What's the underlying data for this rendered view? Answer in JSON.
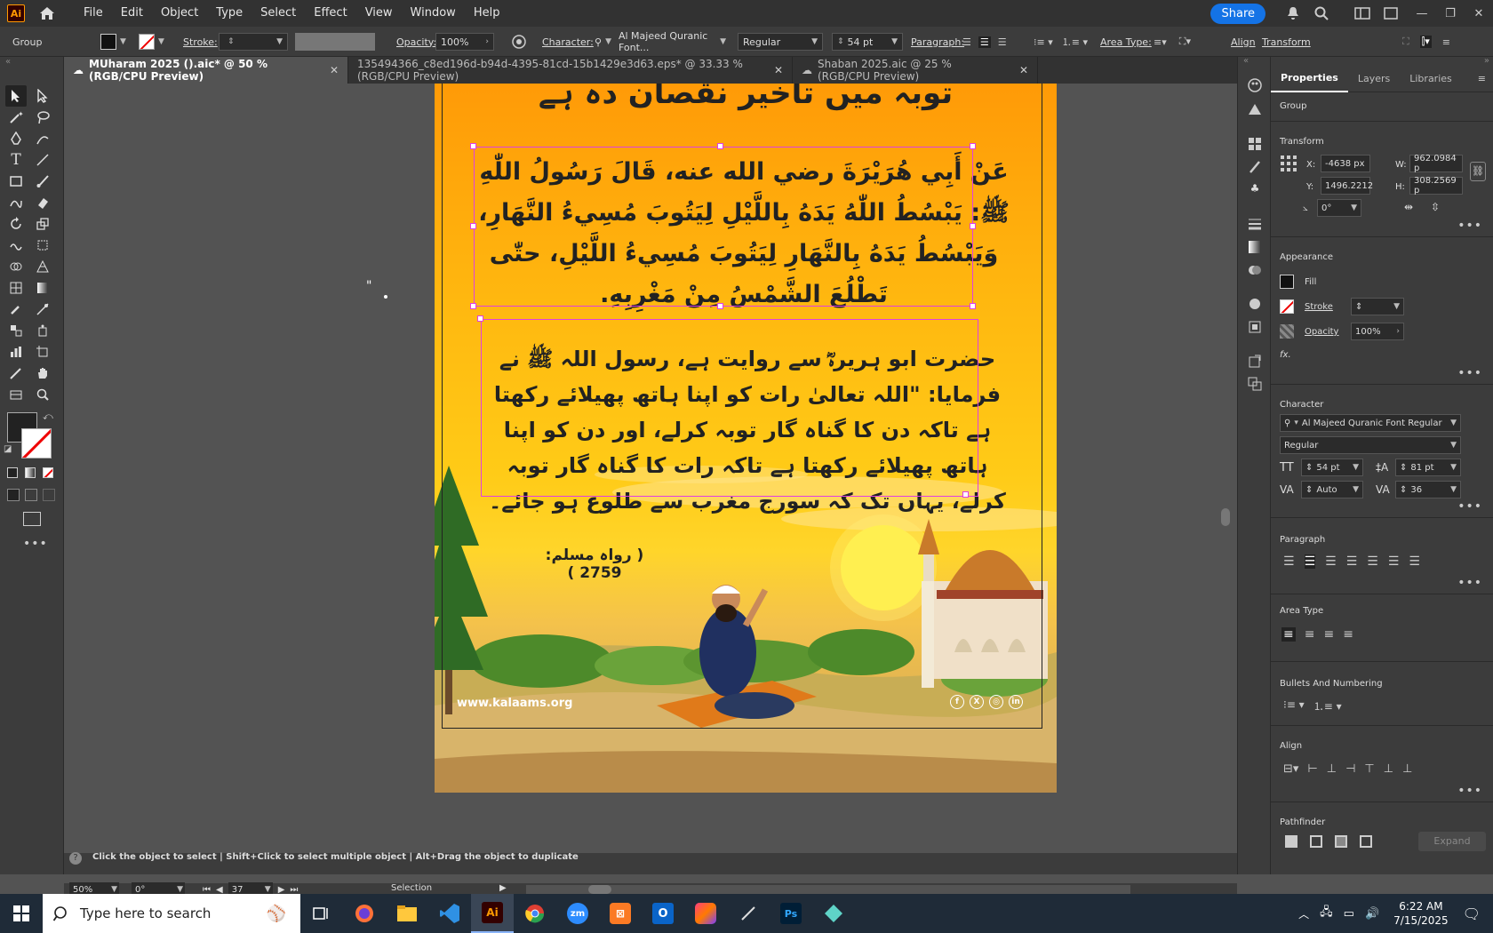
{
  "menubar": {
    "logo": "Ai",
    "items": [
      "File",
      "Edit",
      "Object",
      "Type",
      "Select",
      "Effect",
      "View",
      "Window",
      "Help"
    ],
    "share": "Share"
  },
  "controlbar": {
    "selection": "Group",
    "stroke_label": "Stroke:",
    "opacity_label": "Opacity:",
    "opacity_value": "100%",
    "character_label": "Character:",
    "font": "Al Majeed Quranic Font...",
    "style": "Regular",
    "size": "54 pt",
    "paragraph_label": "Paragraph:",
    "area_type_label": "Area Type:",
    "align": "Align",
    "transform": "Transform"
  },
  "tabs": [
    {
      "label": "MUharam 2025 ().aic* @ 50 % (RGB/CPU Preview)",
      "active": true
    },
    {
      "label": "135494366_c8ed196d-b94d-4395-81cd-15b1429e3d63.eps* @ 33.33 % (RGB/CPU Preview)"
    },
    {
      "label": "Shaban 2025.aic @ 25 % (RGB/CPU Preview)"
    }
  ],
  "artboard": {
    "heading": "توبہ میں تاخیر نقصان دہ ہے",
    "arabic_text": "عَنْ أَبِي هُرَيْرَةَ رضي الله عنه، قَالَ رَسُولُ اللّٰهِ ﷺ: يَبْسُطُ اللّٰهُ يَدَهُ بِاللَّيْلِ لِيَتُوبَ مُسِيءُ النَّهَارِ، وَيَبْسُطُ يَدَهُ بِالنَّهَارِ لِيَتُوبَ مُسِيءُ اللَّيْلِ، حتّٰى تَطْلُعَ الشَّمْسُ مِنْ مَغْرِبِهِ.",
    "urdu_text": "حضرت ابو ہریرہؓ سے روایت ہے، رسول اللہ ﷺ نے فرمایا: \"اللہ تعالیٰ رات کو اپنا ہاتھ پھیلائے رکھتا ہے تاکہ دن کا گناہ گار توبہ کرلے، اور دن کو اپنا ہاتھ پھیلائے رکھتا ہے تاکہ رات کا گناہ گار توبہ کرلے، یہاں تک کہ سورج مغرب سے طلوع ہو جائے۔",
    "reference": "( رواہ مسلم: 2759 )",
    "website": "www.kalaams.org",
    "stray_mark": "\""
  },
  "statusbar": {
    "hint": "Click the object to select  |  Shift+Click to select multiple object  |  Alt+Drag the object to duplicate",
    "zoom": "50%",
    "rotation": "0°",
    "artboard_num": "37",
    "mode": "Selection"
  },
  "properties": {
    "tabs": [
      "Properties",
      "Layers",
      "Libraries"
    ],
    "selection": "Group",
    "transform_title": "Transform",
    "x_label": "X:",
    "x": "-4638 px",
    "y_label": "Y:",
    "y": "1496.2212",
    "w_label": "W:",
    "w": "962.0984 p",
    "h_label": "H:",
    "h": "308.2569 p",
    "angle": "0°",
    "appearance_title": "Appearance",
    "fill": "Fill",
    "stroke": "Stroke",
    "opacity_label": "Opacity",
    "opacity": "100%",
    "fx": "fx.",
    "character_title": "Character",
    "font": "Al Majeed Quranic Font Regular",
    "style": "Regular",
    "size": "54 pt",
    "leading": "81 pt",
    "kerning": "Auto",
    "tracking": "36",
    "paragraph_title": "Paragraph",
    "area_type_title": "Area Type",
    "bullets_title": "Bullets And Numbering",
    "align_title": "Align",
    "pathfinder_title": "Pathfinder",
    "expand": "Expand"
  },
  "taskbar": {
    "search_placeholder": "Type here to search",
    "time": "6:22 AM",
    "date": "7/15/2025"
  },
  "colors": {
    "accent": "#1473e6",
    "selection": "#e040e0",
    "ai_orange": "#ff9a00"
  }
}
